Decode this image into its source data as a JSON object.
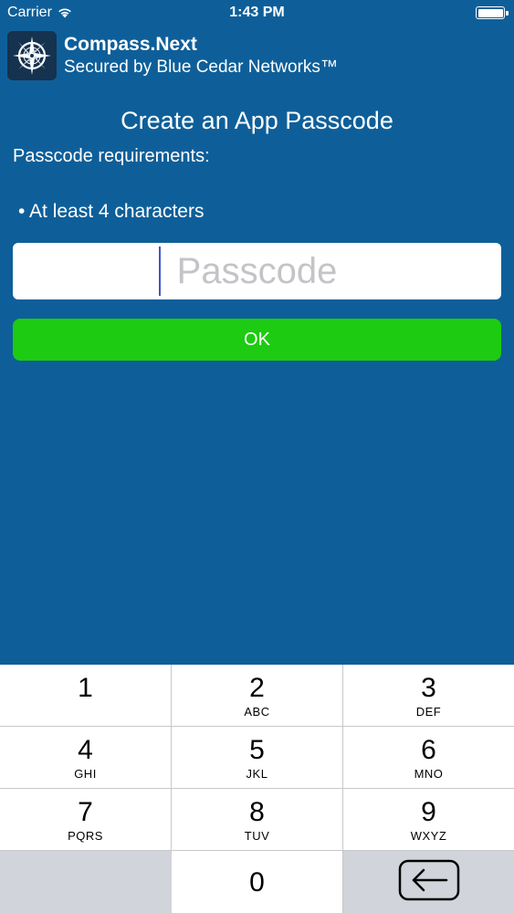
{
  "status_bar": {
    "carrier": "Carrier",
    "time": "1:43 PM"
  },
  "app": {
    "title": "Compass.Next",
    "subtitle": "Secured by Blue Cedar Networks™",
    "logo_icon": "compass-rose-icon"
  },
  "screen": {
    "title": "Create an App Passcode",
    "requirements_heading": "Passcode requirements:",
    "requirements": [
      "• At least 4 characters"
    ]
  },
  "passcode_field": {
    "placeholder": "Passcode",
    "value": ""
  },
  "ok_button": {
    "label": "OK"
  },
  "keypad": {
    "keys": [
      {
        "digit": "1",
        "letters": ""
      },
      {
        "digit": "2",
        "letters": "ABC"
      },
      {
        "digit": "3",
        "letters": "DEF"
      },
      {
        "digit": "4",
        "letters": "GHI"
      },
      {
        "digit": "5",
        "letters": "JKL"
      },
      {
        "digit": "6",
        "letters": "MNO"
      },
      {
        "digit": "7",
        "letters": "PQRS"
      },
      {
        "digit": "8",
        "letters": "TUV"
      },
      {
        "digit": "9",
        "letters": "WXYZ"
      },
      {
        "digit": "0",
        "letters": ""
      }
    ],
    "backspace_icon": "backspace-icon"
  },
  "colors": {
    "background": "#0e5f99",
    "ok_button": "#1dcb12",
    "caret": "#3d56c9",
    "keypad_gray": "#d1d4da"
  }
}
